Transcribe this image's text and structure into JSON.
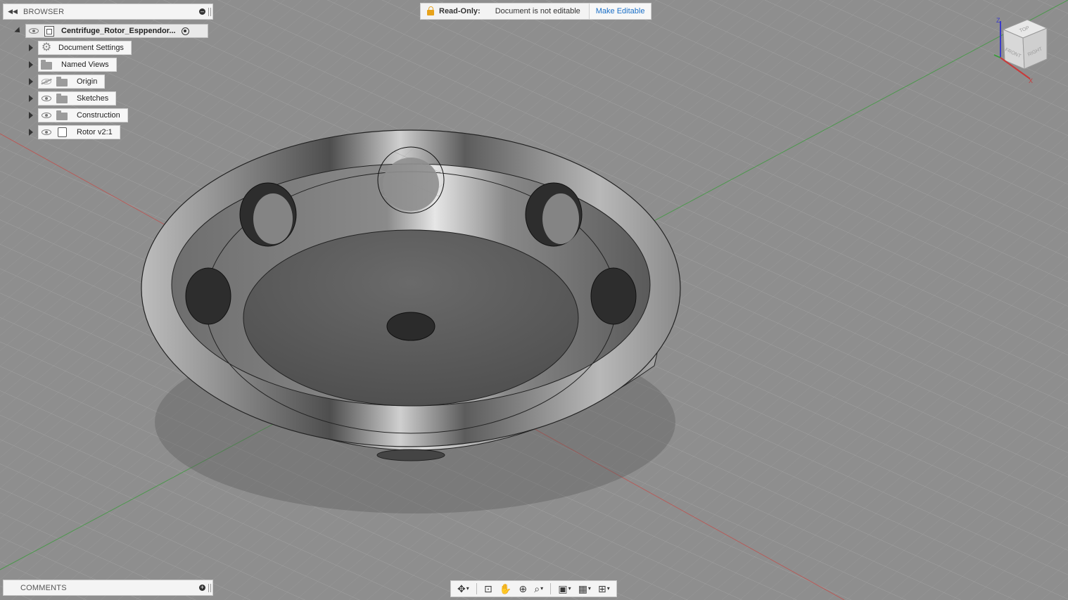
{
  "browser": {
    "title": "BROWSER",
    "root": {
      "label": "Centrifuge_Rotor_Esppendor..."
    },
    "items": [
      {
        "label": "Document Settings",
        "icon": "gear-icon",
        "visibility": "none"
      },
      {
        "label": "Named Views",
        "icon": "folder-icon",
        "visibility": "none"
      },
      {
        "label": "Origin",
        "icon": "folder-icon",
        "visibility": "hidden"
      },
      {
        "label": "Sketches",
        "icon": "folder-icon",
        "visibility": "visible"
      },
      {
        "label": "Construction",
        "icon": "folder-icon",
        "visibility": "visible"
      },
      {
        "label": "Rotor v2:1",
        "icon": "body-icon",
        "visibility": "visible"
      }
    ]
  },
  "banner": {
    "title": "Read-Only:",
    "message": "Document is not editable",
    "action": "Make Editable",
    "lock_color": "#e7a21b",
    "action_color": "#1a6fc7"
  },
  "comments": {
    "title": "COMMENTS"
  },
  "viewcube": {
    "top": "TOP",
    "front": "FRONT",
    "right": "RIGHT",
    "axis_z": "Z",
    "axis_x": "X"
  },
  "toolbar": {
    "buttons": [
      "orbit-icon",
      "look-at-icon",
      "pan-icon",
      "zoom-icon",
      "fit-icon",
      "display-settings-icon",
      "grid-settings-icon",
      "viewports-icon"
    ]
  },
  "colors": {
    "grid_line": "#9a9a9a",
    "axis_x": "#c0504d",
    "axis_y": "#3d9a3d",
    "model": "#7a7a7a"
  }
}
